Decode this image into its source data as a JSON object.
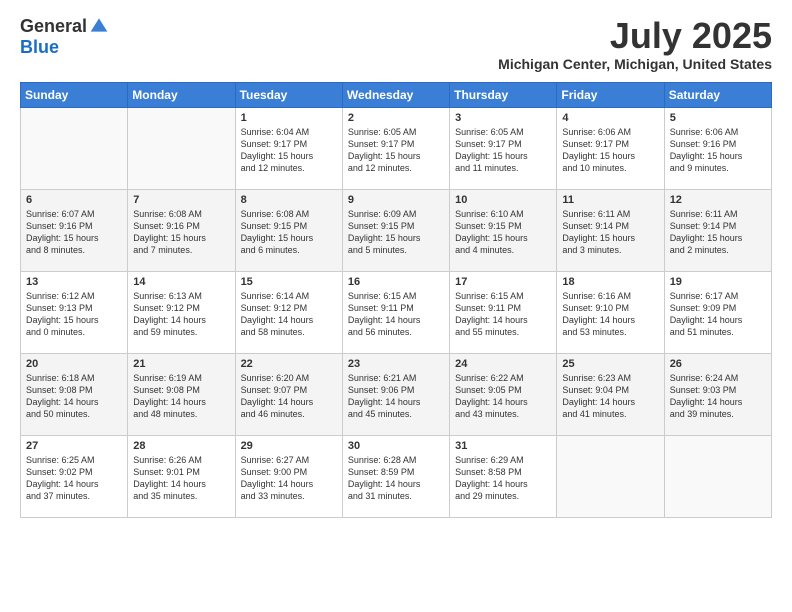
{
  "logo": {
    "general": "General",
    "blue": "Blue"
  },
  "title": "July 2025",
  "location": "Michigan Center, Michigan, United States",
  "weekdays": [
    "Sunday",
    "Monday",
    "Tuesday",
    "Wednesday",
    "Thursday",
    "Friday",
    "Saturday"
  ],
  "weeks": [
    [
      {
        "day": "",
        "info": ""
      },
      {
        "day": "",
        "info": ""
      },
      {
        "day": "1",
        "info": "Sunrise: 6:04 AM\nSunset: 9:17 PM\nDaylight: 15 hours\nand 12 minutes."
      },
      {
        "day": "2",
        "info": "Sunrise: 6:05 AM\nSunset: 9:17 PM\nDaylight: 15 hours\nand 12 minutes."
      },
      {
        "day": "3",
        "info": "Sunrise: 6:05 AM\nSunset: 9:17 PM\nDaylight: 15 hours\nand 11 minutes."
      },
      {
        "day": "4",
        "info": "Sunrise: 6:06 AM\nSunset: 9:17 PM\nDaylight: 15 hours\nand 10 minutes."
      },
      {
        "day": "5",
        "info": "Sunrise: 6:06 AM\nSunset: 9:16 PM\nDaylight: 15 hours\nand 9 minutes."
      }
    ],
    [
      {
        "day": "6",
        "info": "Sunrise: 6:07 AM\nSunset: 9:16 PM\nDaylight: 15 hours\nand 8 minutes."
      },
      {
        "day": "7",
        "info": "Sunrise: 6:08 AM\nSunset: 9:16 PM\nDaylight: 15 hours\nand 7 minutes."
      },
      {
        "day": "8",
        "info": "Sunrise: 6:08 AM\nSunset: 9:15 PM\nDaylight: 15 hours\nand 6 minutes."
      },
      {
        "day": "9",
        "info": "Sunrise: 6:09 AM\nSunset: 9:15 PM\nDaylight: 15 hours\nand 5 minutes."
      },
      {
        "day": "10",
        "info": "Sunrise: 6:10 AM\nSunset: 9:15 PM\nDaylight: 15 hours\nand 4 minutes."
      },
      {
        "day": "11",
        "info": "Sunrise: 6:11 AM\nSunset: 9:14 PM\nDaylight: 15 hours\nand 3 minutes."
      },
      {
        "day": "12",
        "info": "Sunrise: 6:11 AM\nSunset: 9:14 PM\nDaylight: 15 hours\nand 2 minutes."
      }
    ],
    [
      {
        "day": "13",
        "info": "Sunrise: 6:12 AM\nSunset: 9:13 PM\nDaylight: 15 hours\nand 0 minutes."
      },
      {
        "day": "14",
        "info": "Sunrise: 6:13 AM\nSunset: 9:12 PM\nDaylight: 14 hours\nand 59 minutes."
      },
      {
        "day": "15",
        "info": "Sunrise: 6:14 AM\nSunset: 9:12 PM\nDaylight: 14 hours\nand 58 minutes."
      },
      {
        "day": "16",
        "info": "Sunrise: 6:15 AM\nSunset: 9:11 PM\nDaylight: 14 hours\nand 56 minutes."
      },
      {
        "day": "17",
        "info": "Sunrise: 6:15 AM\nSunset: 9:11 PM\nDaylight: 14 hours\nand 55 minutes."
      },
      {
        "day": "18",
        "info": "Sunrise: 6:16 AM\nSunset: 9:10 PM\nDaylight: 14 hours\nand 53 minutes."
      },
      {
        "day": "19",
        "info": "Sunrise: 6:17 AM\nSunset: 9:09 PM\nDaylight: 14 hours\nand 51 minutes."
      }
    ],
    [
      {
        "day": "20",
        "info": "Sunrise: 6:18 AM\nSunset: 9:08 PM\nDaylight: 14 hours\nand 50 minutes."
      },
      {
        "day": "21",
        "info": "Sunrise: 6:19 AM\nSunset: 9:08 PM\nDaylight: 14 hours\nand 48 minutes."
      },
      {
        "day": "22",
        "info": "Sunrise: 6:20 AM\nSunset: 9:07 PM\nDaylight: 14 hours\nand 46 minutes."
      },
      {
        "day": "23",
        "info": "Sunrise: 6:21 AM\nSunset: 9:06 PM\nDaylight: 14 hours\nand 45 minutes."
      },
      {
        "day": "24",
        "info": "Sunrise: 6:22 AM\nSunset: 9:05 PM\nDaylight: 14 hours\nand 43 minutes."
      },
      {
        "day": "25",
        "info": "Sunrise: 6:23 AM\nSunset: 9:04 PM\nDaylight: 14 hours\nand 41 minutes."
      },
      {
        "day": "26",
        "info": "Sunrise: 6:24 AM\nSunset: 9:03 PM\nDaylight: 14 hours\nand 39 minutes."
      }
    ],
    [
      {
        "day": "27",
        "info": "Sunrise: 6:25 AM\nSunset: 9:02 PM\nDaylight: 14 hours\nand 37 minutes."
      },
      {
        "day": "28",
        "info": "Sunrise: 6:26 AM\nSunset: 9:01 PM\nDaylight: 14 hours\nand 35 minutes."
      },
      {
        "day": "29",
        "info": "Sunrise: 6:27 AM\nSunset: 9:00 PM\nDaylight: 14 hours\nand 33 minutes."
      },
      {
        "day": "30",
        "info": "Sunrise: 6:28 AM\nSunset: 8:59 PM\nDaylight: 14 hours\nand 31 minutes."
      },
      {
        "day": "31",
        "info": "Sunrise: 6:29 AM\nSunset: 8:58 PM\nDaylight: 14 hours\nand 29 minutes."
      },
      {
        "day": "",
        "info": ""
      },
      {
        "day": "",
        "info": ""
      }
    ]
  ]
}
